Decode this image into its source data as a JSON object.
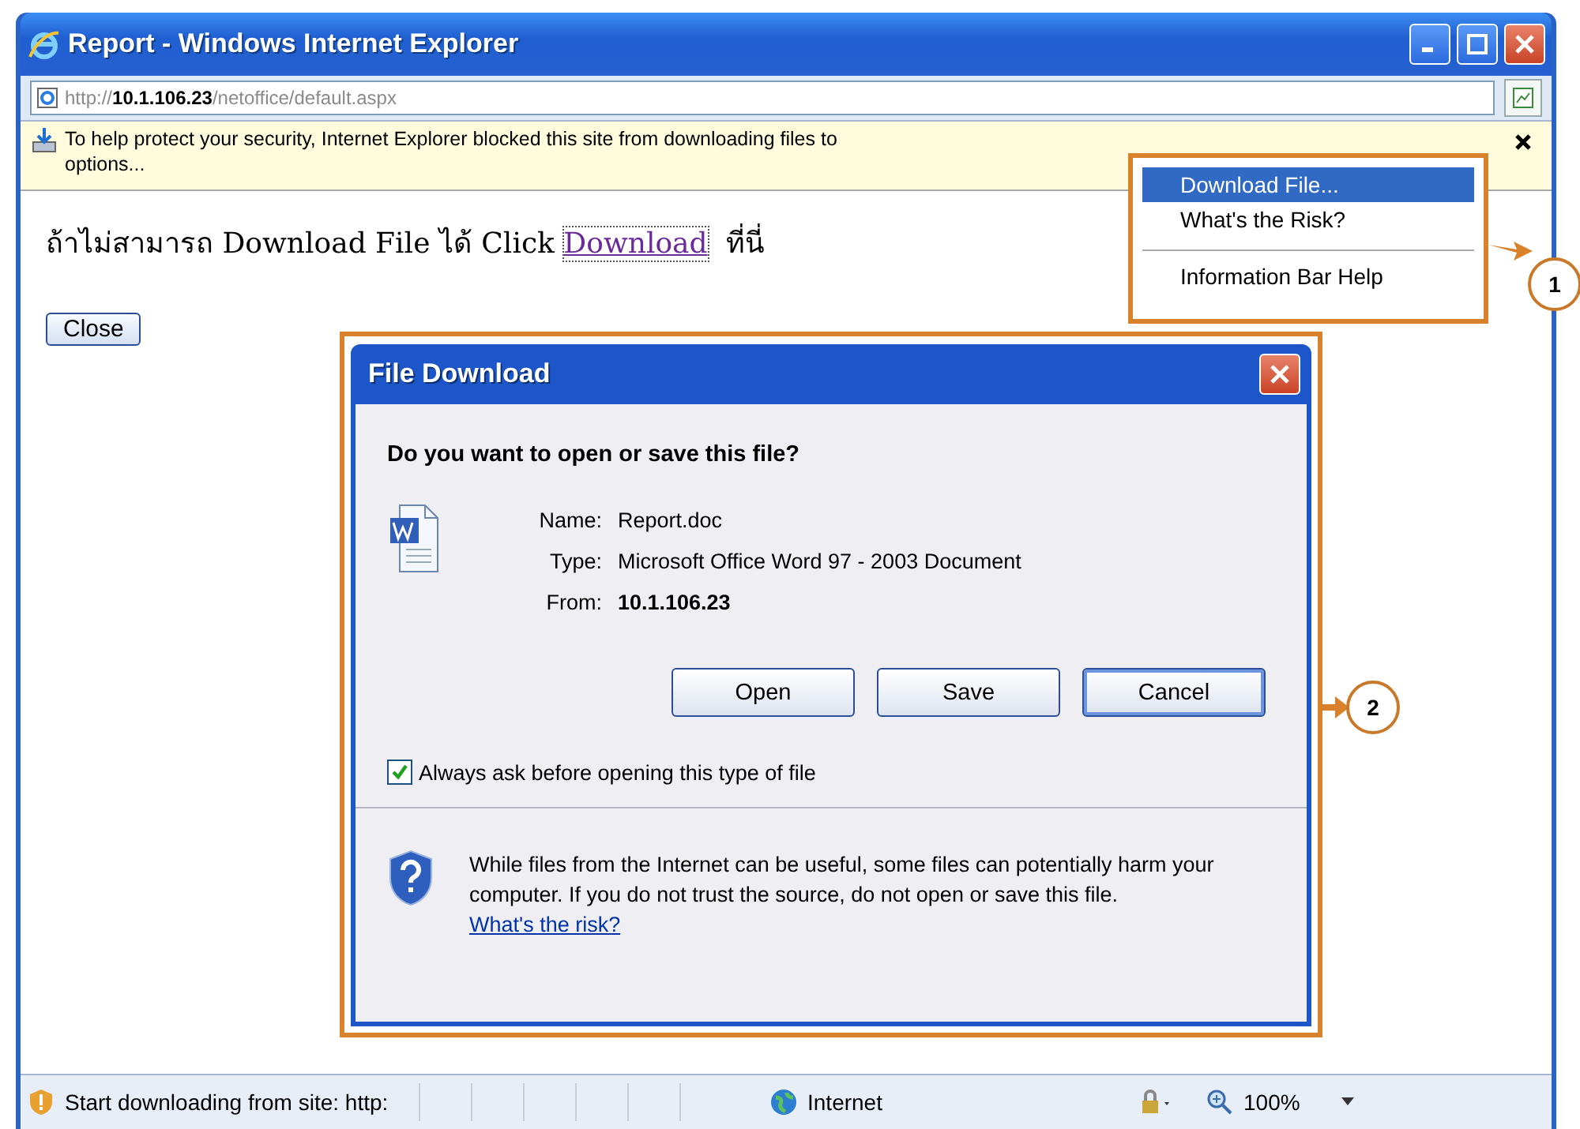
{
  "window": {
    "title": "Report - Windows Internet Explorer"
  },
  "address_bar": {
    "url": "http://**10.1.106.23**/netoffice/default.aspx"
  },
  "info_bar": {
    "lines": [
      "To help protect your security, Internet Explorer blocked this site from downloading files to",
      "options..."
    ]
  },
  "info_menu": {
    "items": [
      {
        "label": "Download File...",
        "selected": true,
        "separator_before": false
      },
      {
        "label": "What's the Risk?",
        "selected": false,
        "separator_before": false
      },
      {
        "label": "Information Bar Help",
        "selected": false,
        "separator_before": true
      }
    ]
  },
  "page": {
    "text_before": "ถ้าไม่สามารถ Download File ได้ Click",
    "link": "Download",
    "text_after": "ที่นี่",
    "close_button": "Close"
  },
  "dialog": {
    "title": "File Download",
    "question": "Do you want to open or save this file?",
    "fields": [
      {
        "label": "Name:",
        "value": "Report.doc",
        "bold": false
      },
      {
        "label": "Type:",
        "value": "Microsoft Office Word 97 - 2003 Document",
        "bold": false
      },
      {
        "label": "From:",
        "value": "10.1.106.23",
        "bold": true
      }
    ],
    "buttons": [
      {
        "label": "Open",
        "default": false
      },
      {
        "label": "Save",
        "default": false
      },
      {
        "label": "Cancel",
        "default": true
      }
    ],
    "checkbox": {
      "label": "Always ask before opening this type of file",
      "checked": true
    },
    "warning": {
      "text": "While files from the Internet can be useful, some files can potentially harm your computer. If you do not trust the source, do not open or save this file.",
      "link": "What's the risk?"
    }
  },
  "status_bar": {
    "text": "Start downloading from site: http:",
    "zone": "Internet",
    "zoom": "100%"
  },
  "callouts": [
    "1",
    "2"
  ]
}
